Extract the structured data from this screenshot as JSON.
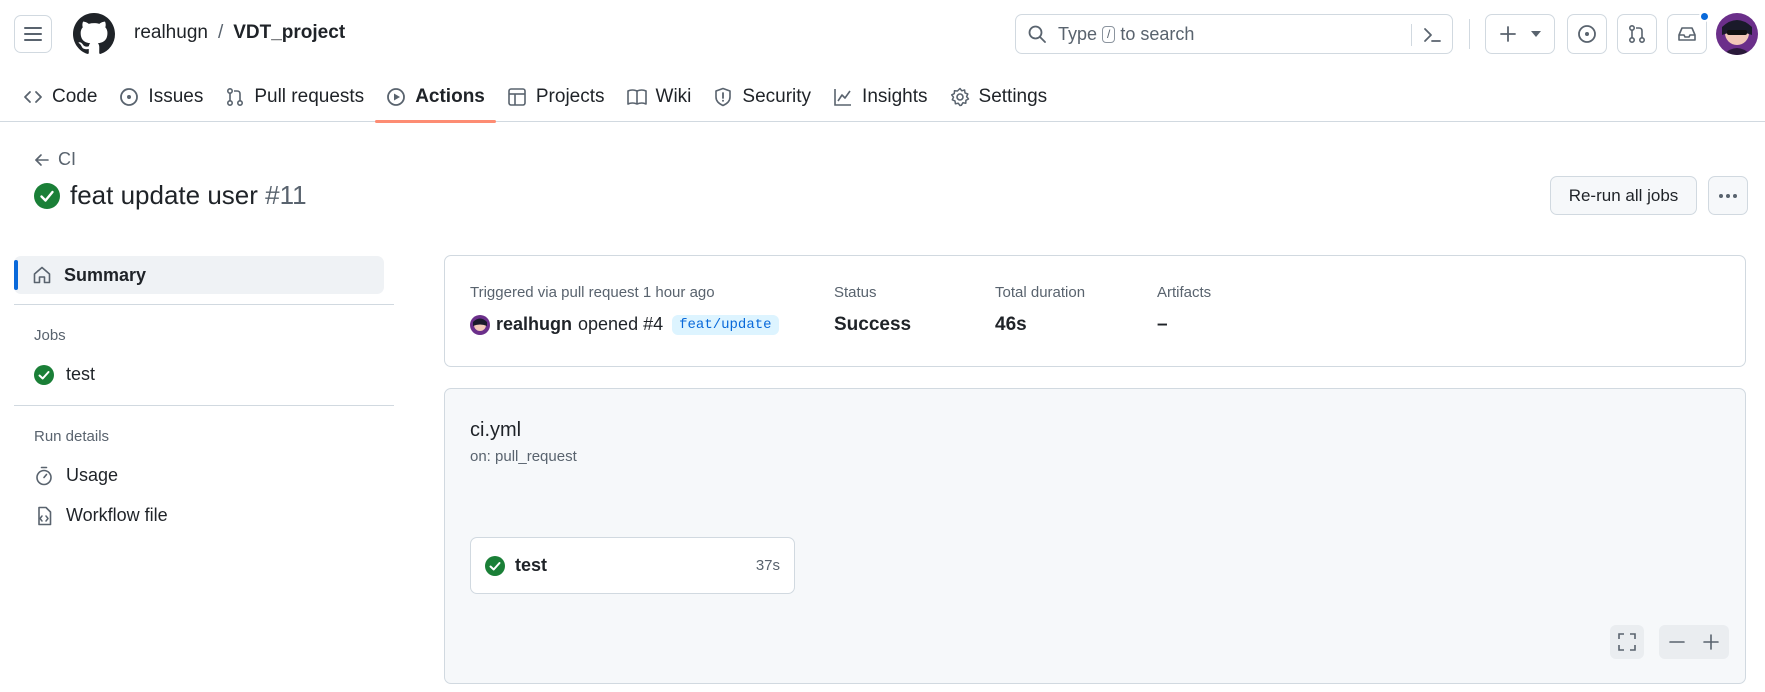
{
  "header": {
    "owner": "realhugn",
    "separator": "/",
    "repo": "VDT_project",
    "search_placeholder_pre": "Type",
    "search_key": "/",
    "search_placeholder_post": "to search"
  },
  "nav": {
    "tabs": [
      {
        "label": "Code",
        "icon": "code-icon"
      },
      {
        "label": "Issues",
        "icon": "issue-icon"
      },
      {
        "label": "Pull requests",
        "icon": "pull-request-icon"
      },
      {
        "label": "Actions",
        "icon": "play-icon",
        "active": true
      },
      {
        "label": "Projects",
        "icon": "table-icon"
      },
      {
        "label": "Wiki",
        "icon": "book-icon"
      },
      {
        "label": "Security",
        "icon": "shield-icon"
      },
      {
        "label": "Insights",
        "icon": "graph-icon"
      },
      {
        "label": "Settings",
        "icon": "gear-icon"
      }
    ]
  },
  "run": {
    "back_label": "CI",
    "title": "feat update user",
    "number": "#11",
    "status": "success",
    "rerun_label": "Re-run all jobs"
  },
  "sidebar": {
    "summary_label": "Summary",
    "jobs_heading": "Jobs",
    "jobs": [
      {
        "name": "test",
        "status": "success"
      }
    ],
    "run_details_heading": "Run details",
    "usage_label": "Usage",
    "workflow_file_label": "Workflow file"
  },
  "summary": {
    "trigger_text": "Triggered via pull request 1 hour ago",
    "actor": "realhugn",
    "action_text": "opened #4",
    "branch": "feat/update",
    "status_label": "Status",
    "status_value": "Success",
    "duration_label": "Total duration",
    "duration_value": "46s",
    "artifacts_label": "Artifacts",
    "artifacts_value": "–"
  },
  "workflow": {
    "file": "ci.yml",
    "on": "on: pull_request",
    "job": {
      "name": "test",
      "duration": "37s"
    }
  },
  "colors": {
    "success": "#1a7f37",
    "accent": "#0969da",
    "active_tab_underline": "#fd8c73"
  }
}
